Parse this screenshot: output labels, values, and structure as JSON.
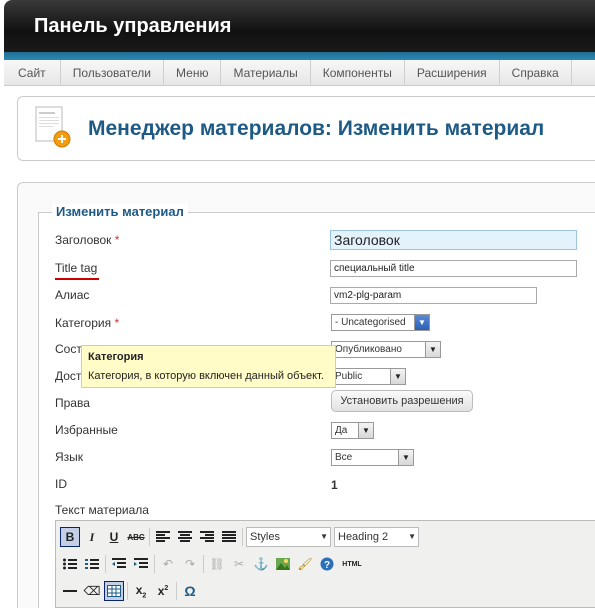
{
  "header": {
    "title": "Панель управления"
  },
  "menu": [
    "Сайт",
    "Пользователи",
    "Меню",
    "Материалы",
    "Компоненты",
    "Расширения",
    "Справка"
  ],
  "page": {
    "title": "Менеджер материалов: Изменить материал"
  },
  "form": {
    "legend": "Изменить материал",
    "labels": {
      "title": "Заголовок",
      "title_tag": "Title tag",
      "alias": "Алиас",
      "category": "Категория",
      "state": "Сост",
      "access": "Дост",
      "rights": "Права",
      "featured": "Избранные",
      "language": "Язык",
      "id": "ID",
      "text": "Текст материала"
    },
    "required_mark": "*",
    "values": {
      "title": "Заголовок",
      "title_tag": "специальный title",
      "alias": "vm2-plg-param",
      "category": "- Uncategorised",
      "state": "Опубликовано",
      "access": "Public",
      "featured": "Да",
      "language": "Все",
      "id": "1"
    },
    "permissions_button": "Установить разрешения"
  },
  "tooltip": {
    "title": "Категория",
    "text": "Категория, в которую включен данный объект."
  },
  "editor": {
    "styles_select": "Styles",
    "format_select": "Heading 2",
    "html_label": "HTML"
  },
  "colors": {
    "accent": "#1d5a85",
    "header_bg": "#111111",
    "header_line": "#2b8ab5",
    "tooltip_bg": "#fffcc8",
    "required": "#cc3333"
  }
}
